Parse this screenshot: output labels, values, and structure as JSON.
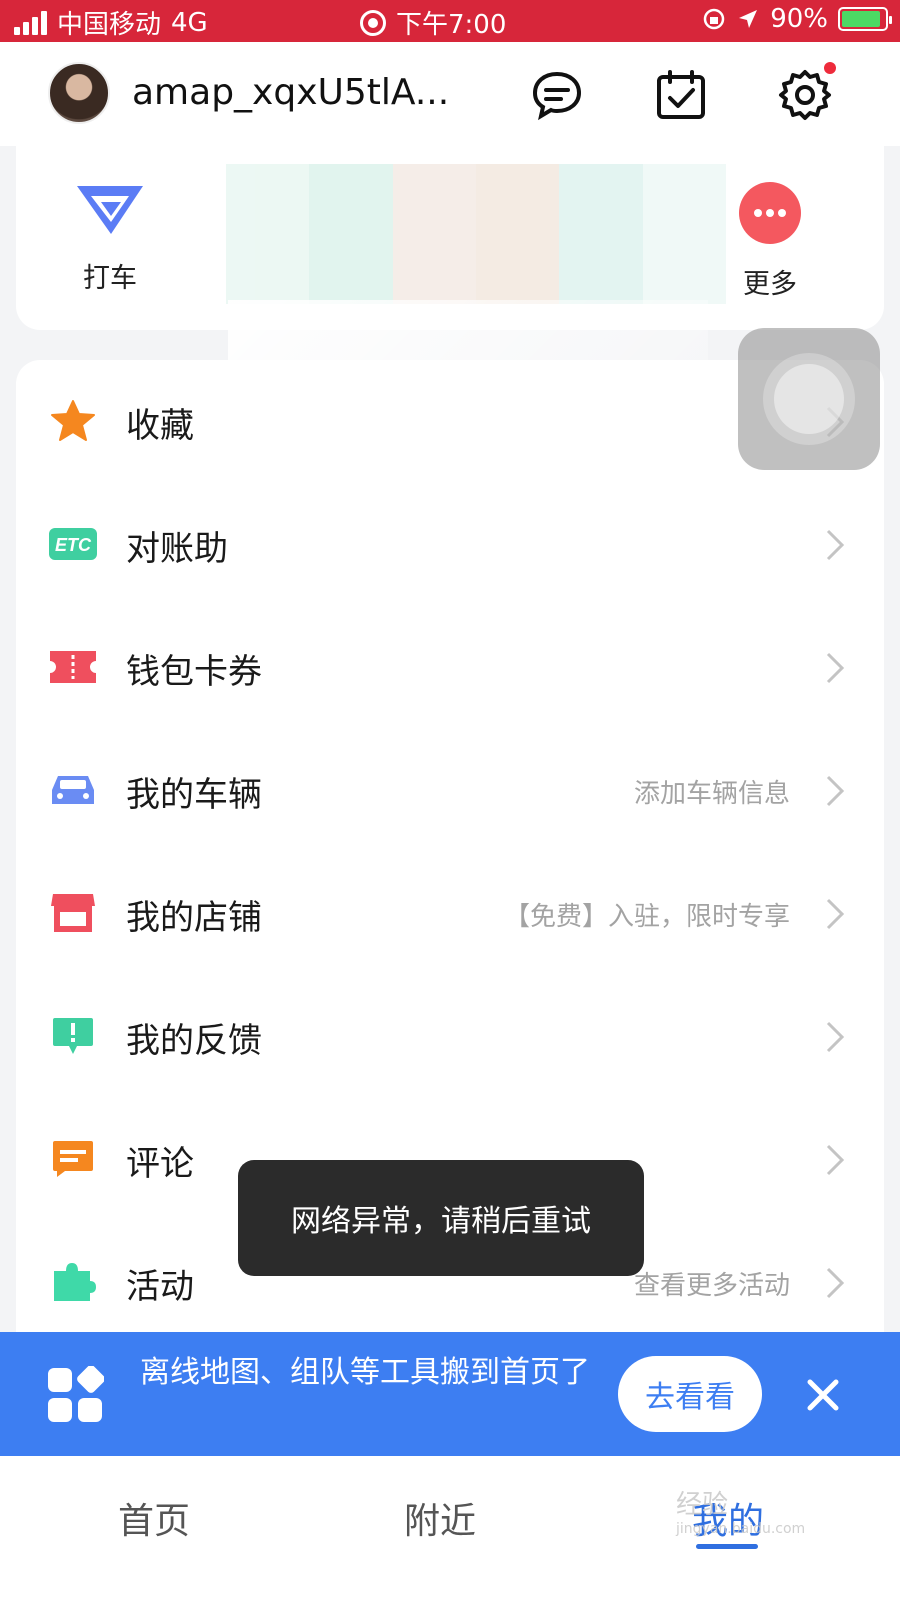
{
  "status_bar": {
    "carrier": "中国移动",
    "network": "4G",
    "time": "下午7:00",
    "battery": "90%"
  },
  "header": {
    "username": "amap_xqxU5tlA...",
    "icons": [
      "chat-icon",
      "calendar-check-icon",
      "gear-icon"
    ]
  },
  "tiles": [
    {
      "label": "打车",
      "icon": "taxi-icon"
    },
    {
      "label": "更多",
      "icon": "more-icon"
    }
  ],
  "menu": [
    {
      "label": "收藏",
      "hint": "",
      "icon": "star-icon"
    },
    {
      "label": "对账助",
      "hint": "",
      "icon": "etc-icon"
    },
    {
      "label": "钱包卡券",
      "hint": "",
      "icon": "ticket-icon"
    },
    {
      "label": "我的车辆",
      "hint": "添加车辆信息",
      "icon": "car-icon"
    },
    {
      "label": "我的店铺",
      "hint": "【免费】入驻，限时专享",
      "icon": "store-icon"
    },
    {
      "label": "我的反馈",
      "hint": "",
      "icon": "feedback-icon"
    },
    {
      "label": "评论",
      "hint": "",
      "icon": "comment-icon"
    },
    {
      "label": "活动",
      "hint": "查看更多活动",
      "icon": "puzzle-icon"
    }
  ],
  "toast": "网络异常，请稍后重试",
  "banner": {
    "text": "离线地图、组队等工具搬到首页了",
    "button": "去看看"
  },
  "tabbar": {
    "tabs": [
      "首页",
      "附近",
      "我的"
    ],
    "active": "我的"
  },
  "watermark": {
    "text": "经验",
    "sub": "jingyan.baidu.com"
  },
  "colors": {
    "status_bar": "#d7263a",
    "primary_blue": "#3d7ef2",
    "star_orange": "#f5871f",
    "etc_green": "#3fcfa0",
    "ticket_red": "#ef4f5e",
    "car_blue": "#6a8cf3"
  }
}
